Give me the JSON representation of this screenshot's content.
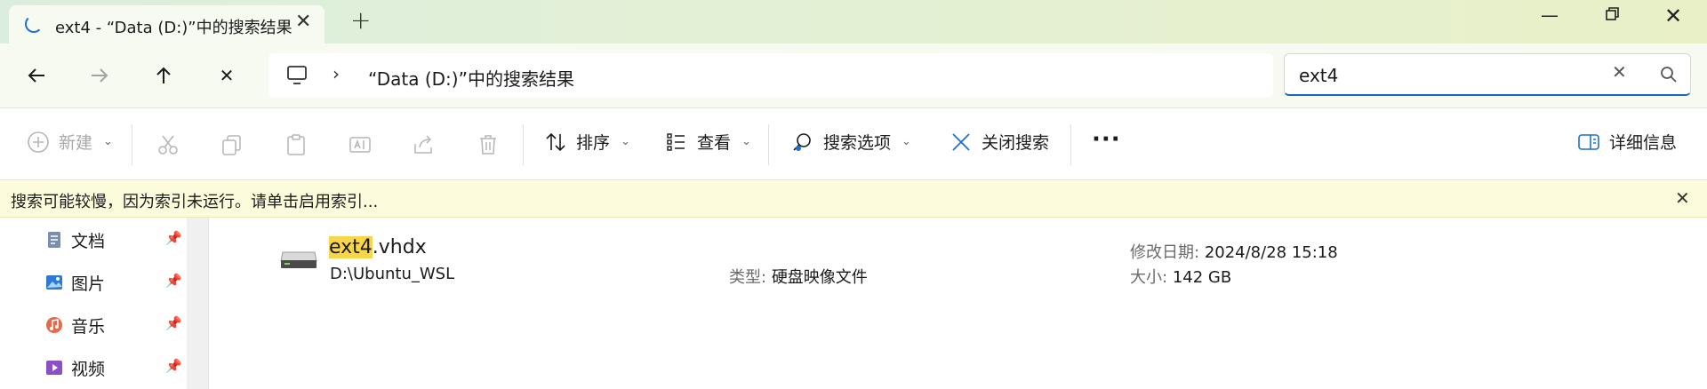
{
  "tab": {
    "title": "ext4 - “Data (D:)”中的搜索结果"
  },
  "nav": {
    "address": "“Data (D:)”中的搜索结果",
    "search_value": "ext4"
  },
  "commands": {
    "new": "新建",
    "sort": "排序",
    "view": "查看",
    "search_options": "搜索选项",
    "close_search": "关闭搜索",
    "details": "详细信息"
  },
  "info": {
    "message": "搜索可能较慢，因为索引未运行。请单击启用索引..."
  },
  "sidebar": {
    "items": [
      {
        "label": "文档"
      },
      {
        "label": "图片"
      },
      {
        "label": "音乐"
      },
      {
        "label": "视频"
      }
    ]
  },
  "result": {
    "name_highlight": "ext4",
    "name_rest": ".vhdx",
    "path": "D:\\Ubuntu_WSL",
    "type_label": "类型:",
    "type_value": "硬盘映像文件",
    "date_label": "修改日期:",
    "date_value": "2024/8/28 15:18",
    "size_label": "大小:",
    "size_value": "142 GB"
  },
  "colors": {
    "accent": "#1a66c2",
    "highlight": "#f7d64a",
    "infobar": "#fcfbdc"
  }
}
